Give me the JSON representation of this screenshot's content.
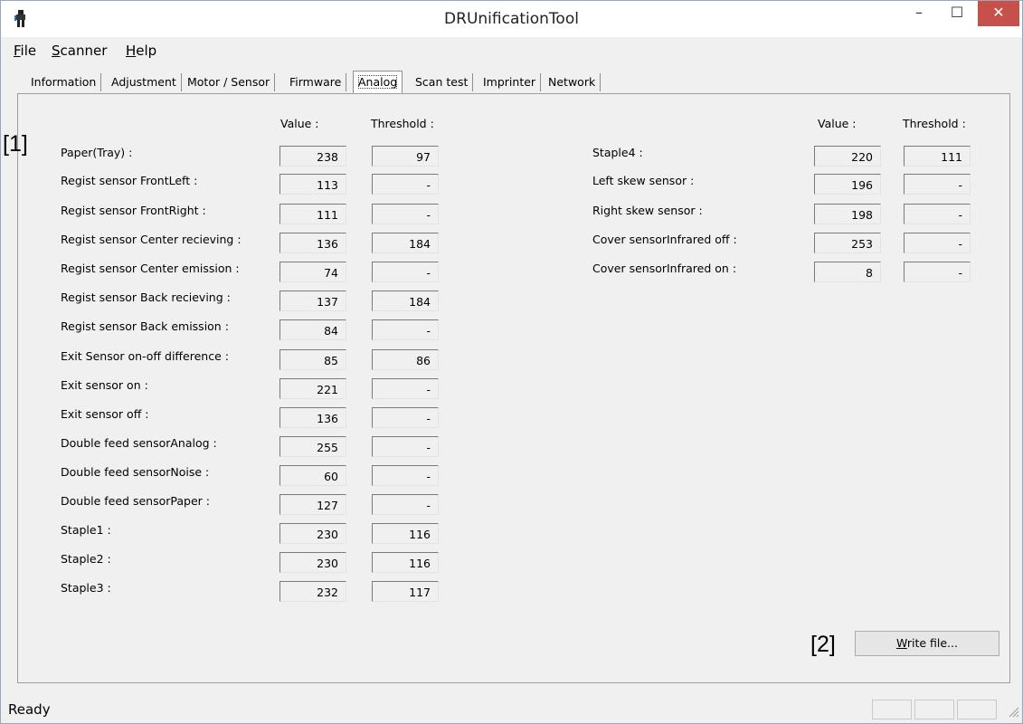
{
  "window": {
    "title": "DRUnificationTool",
    "minimize": "–",
    "maximize": "☐",
    "close": "✕"
  },
  "menu": [
    {
      "first": "F",
      "rest": "ile"
    },
    {
      "first": "S",
      "rest": "canner"
    },
    {
      "first": "H",
      "rest": "elp"
    }
  ],
  "tabs": [
    "Information",
    "Adjustment",
    "Motor / Sensor",
    "Firmware",
    "Analog",
    "Scan test",
    "Imprinter",
    "Network"
  ],
  "active_tab": "Analog",
  "headers": {
    "value": "Value :",
    "threshold": "Threshold :"
  },
  "left_rows": [
    {
      "label": "Paper(Tray) :",
      "value": "238",
      "threshold": "97"
    },
    {
      "label": "Regist sensor FrontLeft :",
      "value": "113",
      "threshold": "-"
    },
    {
      "label": "Regist sensor FrontRight :",
      "value": "111",
      "threshold": "-"
    },
    {
      "label": "Regist sensor Center recieving :",
      "value": "136",
      "threshold": "184"
    },
    {
      "label": "Regist sensor Center emission :",
      "value": "74",
      "threshold": "-"
    },
    {
      "label": "Regist sensor Back recieving :",
      "value": "137",
      "threshold": "184"
    },
    {
      "label": "Regist sensor Back emission :",
      "value": "84",
      "threshold": "-"
    },
    {
      "label": "Exit Sensor on-off difference :",
      "value": "85",
      "threshold": "86"
    },
    {
      "label": "Exit sensor on :",
      "value": "221",
      "threshold": "-"
    },
    {
      "label": "Exit sensor off :",
      "value": "136",
      "threshold": "-"
    },
    {
      "label": "Double feed sensorAnalog :",
      "value": "255",
      "threshold": "-"
    },
    {
      "label": "Double feed sensorNoise :",
      "value": "60",
      "threshold": "-"
    },
    {
      "label": "Double feed sensorPaper :",
      "value": "127",
      "threshold": "-"
    },
    {
      "label": "Staple1 :",
      "value": "230",
      "threshold": "116"
    },
    {
      "label": "Staple2 :",
      "value": "230",
      "threshold": "116"
    },
    {
      "label": "Staple3 :",
      "value": "232",
      "threshold": "117"
    }
  ],
  "right_rows": [
    {
      "label": "Staple4 :",
      "value": "220",
      "threshold": "111"
    },
    {
      "label": "Left skew sensor :",
      "value": "196",
      "threshold": "-"
    },
    {
      "label": "Right skew sensor :",
      "value": "198",
      "threshold": "-"
    },
    {
      "label": "Cover sensorInfrared off :",
      "value": "253",
      "threshold": "-"
    },
    {
      "label": "Cover sensorInfrared on :",
      "value": "8",
      "threshold": "-"
    }
  ],
  "markers": {
    "one": "[1]",
    "two": "[2]"
  },
  "write_button": {
    "first": "W",
    "rest": "rite file..."
  },
  "status": {
    "text": "Ready"
  }
}
